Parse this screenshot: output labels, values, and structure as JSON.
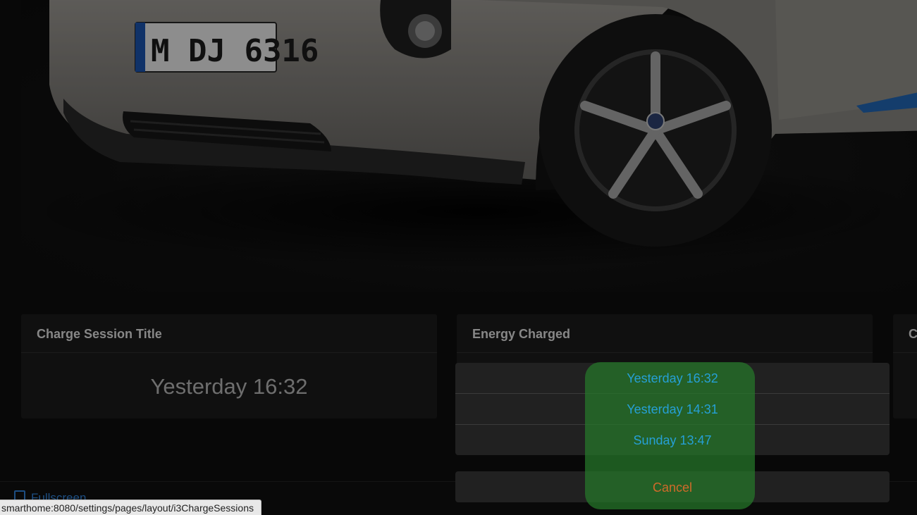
{
  "hero": {
    "license_plate": "M DJ 6316"
  },
  "cards": [
    {
      "title": "Charge Session Title",
      "value": "Yesterday 16:32"
    },
    {
      "title": "Energy Charged",
      "value": ""
    },
    {
      "title": "C",
      "value": ""
    }
  ],
  "footer": {
    "fullscreen_label": "Fullscreen"
  },
  "action_sheet": {
    "options": [
      "Yesterday 16:32",
      "Yesterday 14:31",
      "Sunday 13:47"
    ],
    "cancel_label": "Cancel"
  },
  "status_url": "smarthome:8080/settings/pages/layout/i3ChargeSessions",
  "colors": {
    "option_text": "#26a0d6",
    "cancel_text": "#d06a2a",
    "highlight": "#26782a"
  }
}
